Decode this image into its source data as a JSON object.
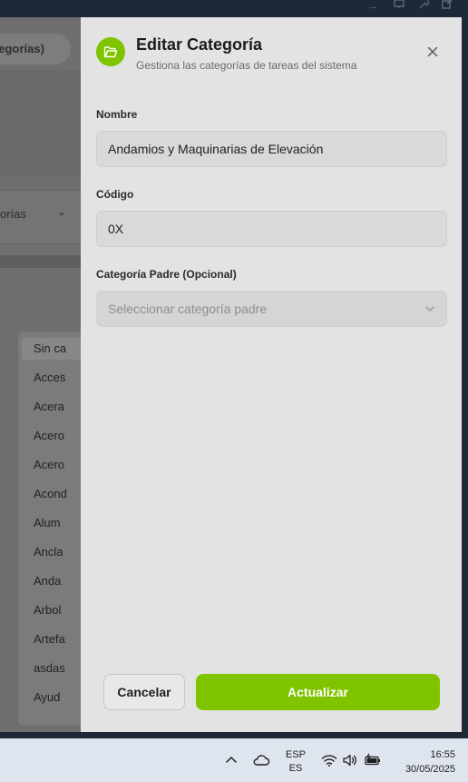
{
  "background_app": {
    "tab_label": "tegorías)",
    "select_text": "orías",
    "list_items": [
      "Sin ca",
      "Acces",
      "Acera",
      "Acero",
      "Acero",
      "Acond",
      "Alum",
      "Ancla",
      "Anda",
      "Arbol",
      "Artefa",
      "asdas",
      "Ayud"
    ]
  },
  "drawer": {
    "icon": "folder-open-icon",
    "title": "Editar Categoría",
    "subtitle": "Gestiona las categorías de tareas del sistema",
    "fields": {
      "nombre_label": "Nombre",
      "nombre_value": "Andamios y Maquinarias de Elevación",
      "codigo_label": "Código",
      "codigo_value": "0X",
      "padre_label": "Categoría Padre (Opcional)",
      "padre_placeholder": "Seleccionar categoría padre"
    },
    "buttons": {
      "cancel": "Cancelar",
      "update": "Actualizar"
    }
  },
  "taskbar": {
    "lang_top": "ESP",
    "lang_bottom": "ES",
    "time": "16:55",
    "date": "30/05/2025"
  },
  "colors": {
    "accent": "#80c400",
    "drawer_bg": "#e3e3e3",
    "overlay": "#6f6f6f",
    "taskbar_bg": "#dfe5ee"
  }
}
